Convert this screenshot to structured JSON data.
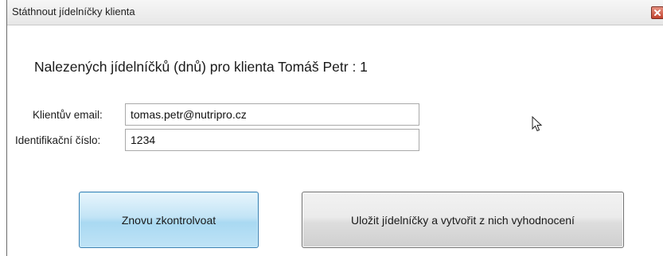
{
  "window": {
    "title": "Státhnout jídelníčky klienta"
  },
  "main": {
    "heading": "Nalezených jídelníčků (dnů) pro klienta Tomáš Petr : 1",
    "email_label": "Klientův email:",
    "email_value": "tomas.petr@nutripro.cz",
    "id_label": "Identifikační číslo:",
    "id_value": "1234"
  },
  "buttons": {
    "recheck_label": "Znovu zkontrolvoat",
    "save_label": "Uložit jídelníčky a vytvořit z nich vyhodnocení"
  },
  "colors": {
    "recheck_button_accent": "#a9d9f2",
    "close_button": "#c1432f"
  },
  "icons": {
    "close": "close-icon",
    "cursor": "mouse-pointer-icon"
  }
}
